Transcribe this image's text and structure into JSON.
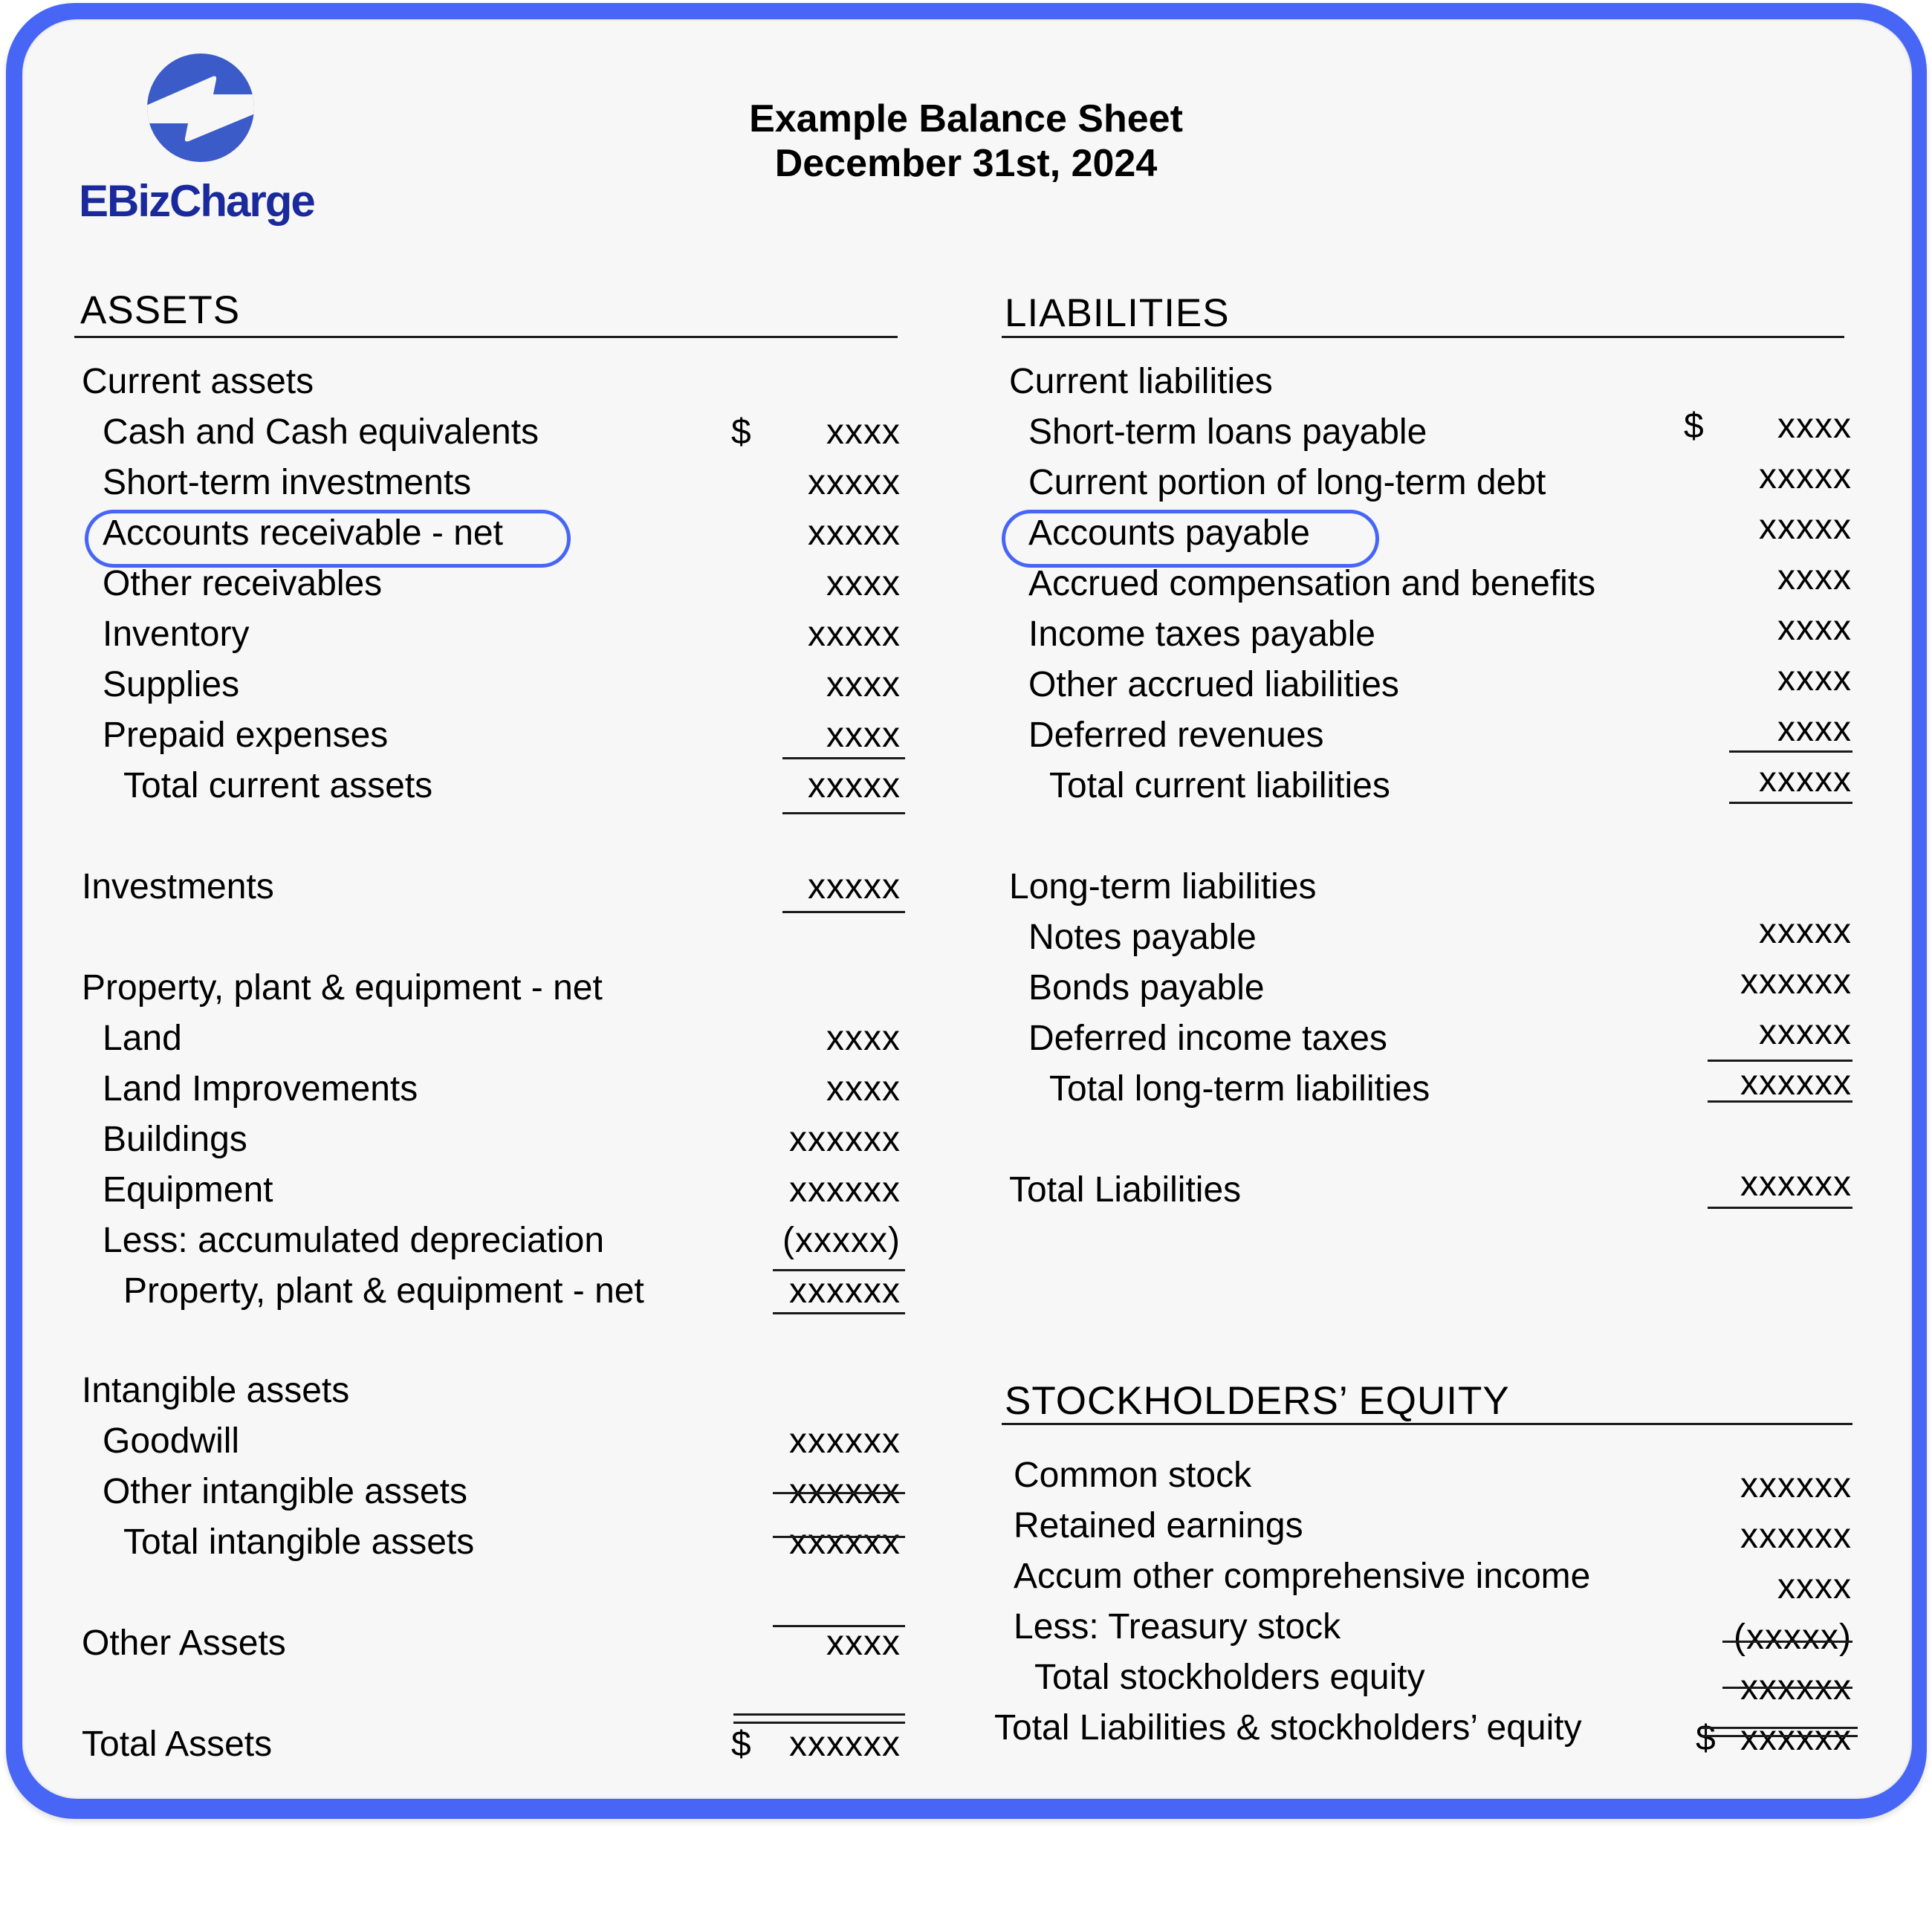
{
  "brand": {
    "name": "EBizCharge",
    "logo_icon": "lightning-bolt-circle-icon",
    "brand_color": "#1a2a9c",
    "logo_color": "#3b5bc8",
    "frame_color": "#4766f5"
  },
  "header": {
    "title": "Example Balance Sheet",
    "date": "December 31st, 2024"
  },
  "assets": {
    "heading": "ASSETS",
    "current": {
      "label": "Current assets",
      "items": [
        {
          "label": "Cash and Cash equivalents",
          "currency": "$",
          "value": "xxxx"
        },
        {
          "label": "Short-term investments",
          "value": "xxxxx"
        },
        {
          "label": "Accounts receivable - net",
          "value": "xxxxx",
          "highlighted": true
        },
        {
          "label": "Other receivables",
          "value": "xxxx"
        },
        {
          "label": "Inventory",
          "value": "xxxxx"
        },
        {
          "label": "Supplies",
          "value": "xxxx"
        },
        {
          "label": "Prepaid expenses",
          "value": "xxxx"
        }
      ],
      "total_label": "Total current assets",
      "total_value": "xxxxx"
    },
    "investments": {
      "label": "Investments",
      "value": "xxxxx"
    },
    "ppe": {
      "label": "Property, plant & equipment - net",
      "items": [
        {
          "label": "Land",
          "value": "xxxx"
        },
        {
          "label": "Land Improvements",
          "value": "xxxx"
        },
        {
          "label": "Buildings",
          "value": "xxxxxx"
        },
        {
          "label": "Equipment",
          "value": "xxxxxx"
        },
        {
          "label": "Less: accumulated depreciation",
          "value": "(xxxxx)"
        }
      ],
      "total_label": "Property, plant & equipment - net",
      "total_value": "xxxxxx"
    },
    "intangible": {
      "label": "Intangible assets",
      "items": [
        {
          "label": "Goodwill",
          "value": "xxxxxx"
        },
        {
          "label": "Other intangible assets",
          "value": "xxxxxx"
        }
      ],
      "total_label": "Total intangible assets",
      "total_value": "xxxxxx"
    },
    "other": {
      "label": "Other Assets",
      "value": "xxxx"
    },
    "total": {
      "label": "Total Assets",
      "currency": "$",
      "value": "xxxxxx"
    }
  },
  "liabilities": {
    "heading": "LIABILITIES",
    "current": {
      "label": "Current liabilities",
      "items": [
        {
          "label": "Short-term loans payable",
          "currency": "$",
          "value": "xxxx"
        },
        {
          "label": "Current portion of long-term debt",
          "value": "xxxxx"
        },
        {
          "label": "Accounts payable",
          "value": "xxxxx",
          "highlighted": true
        },
        {
          "label": "Accrued compensation and benefits",
          "value": "xxxx"
        },
        {
          "label": "Income taxes payable",
          "value": "xxxx"
        },
        {
          "label": "Other accrued liabilities",
          "value": "xxxx"
        },
        {
          "label": "Deferred revenues",
          "value": "xxxx"
        }
      ],
      "total_label": "Total current liabilities",
      "total_value": "xxxxx"
    },
    "long_term": {
      "label": "Long-term liabilities",
      "items": [
        {
          "label": "Notes payable",
          "value": "xxxxx"
        },
        {
          "label": "Bonds payable",
          "value": "xxxxxx"
        },
        {
          "label": "Deferred income taxes",
          "value": "xxxxx"
        }
      ],
      "total_label": "Total long-term liabilities",
      "total_value": "xxxxxx"
    },
    "total": {
      "label": "Total Liabilities",
      "value": "xxxxxx"
    }
  },
  "equity": {
    "heading": "STOCKHOLDERS’ EQUITY",
    "items": [
      {
        "label": "Common stock",
        "value": "xxxxxx"
      },
      {
        "label": "Retained earnings",
        "value": "xxxxxx"
      },
      {
        "label": "Accum other comprehensive income",
        "value": "xxxx"
      },
      {
        "label": "Less: Treasury stock",
        "value": "(xxxxx)"
      }
    ],
    "total_label": "Total stockholders equity",
    "total_value": "xxxxxx",
    "grand_total_label": "Total Liabilities & stockholders’ equity",
    "grand_total_currency": "$",
    "grand_total_value": "xxxxxx"
  }
}
